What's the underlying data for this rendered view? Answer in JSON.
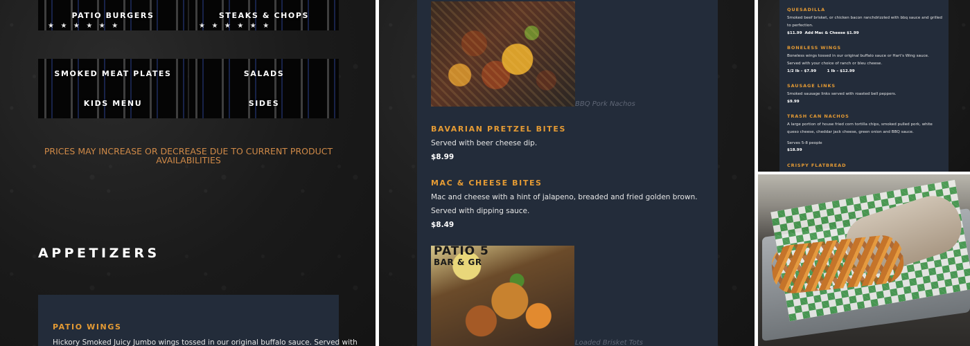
{
  "left": {
    "categories_top": [
      "PATIO BURGERS",
      "STEAKS & CHOPS"
    ],
    "categories_mid": [
      "SMOKED MEAT PLATES",
      "SALADS",
      "KIDS MENU",
      "SIDES"
    ],
    "price_note": "PRICES MAY INCREASE OR DECREASE DUE TO CURRENT PRODUCT AVAILABILITIES",
    "section_title": "APPETIZERS",
    "first_item": {
      "title": "PATIO WINGS",
      "desc": "Hickory Smoked Juicy Jumbo wings tossed in our original buffalo sauce.  Served with"
    }
  },
  "mid": {
    "nachos_caption": "BBQ Pork Nachos",
    "items": [
      {
        "title": "BAVARIAN PRETZEL BITES",
        "desc": "Served with beer cheese dip.",
        "price": "$8.99"
      },
      {
        "title": "MAC & CHEESE BITES",
        "desc": "Mac and cheese with a hint of jalapeno, breaded and fried golden brown.  Served with dipping sauce.",
        "price": "$8.49"
      }
    ],
    "tots_logo_line1": "PATIO 5",
    "tots_logo_line2": "BAR & GR",
    "tots_caption": "Loaded Brisket Tots"
  },
  "right_top": {
    "items": [
      {
        "title": "QUESADILLA",
        "desc": "Smoked beef brisket, or chicken bacon ranchdrizzled with bbq sauce and grilled to perfection.",
        "price": "$11.99  Add Mac & Cheese $1.99"
      },
      {
        "title": "BONELESS WINGS",
        "desc": "Boneless wings tossed in our original buffalo sauce or Hart's Wing sauce.  Served with your choice of ranch or bleu cheese.",
        "price": "1/2 lb – $7.99        1 lb – $12.99"
      },
      {
        "title": "SAUSAGE LINKS",
        "desc": "Smoked sausage links served with roasted bell peppers.",
        "price": "$9.99"
      },
      {
        "title": "TRASH CAN NACHOS",
        "desc": "A large portion of house fried corn tortilla chips, smoked pulled pork, white queso cheese, cheddar jack cheese, green onion and BBQ sauce.",
        "serves": "Serves 5-8 people",
        "price": "$18.99"
      },
      {
        "title": "CRISPY FLATBREAD"
      }
    ]
  }
}
